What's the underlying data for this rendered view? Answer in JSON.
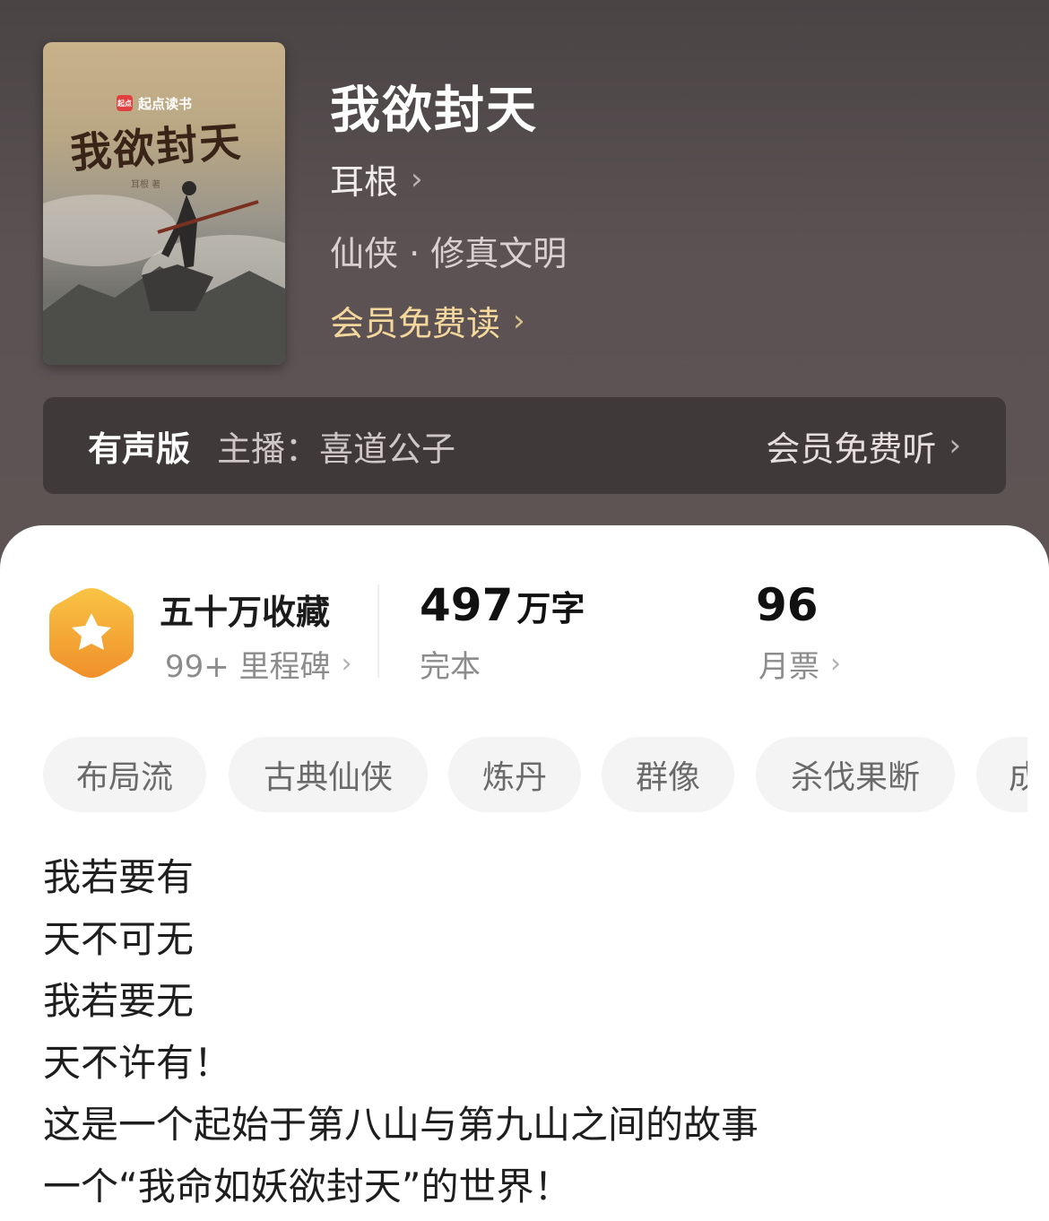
{
  "book": {
    "cover": {
      "brand": "起点读书",
      "title_art": "我欲封天",
      "author_small": "耳根 著"
    },
    "title": "我欲封天",
    "author": "耳根",
    "category": "仙侠 · 修真文明",
    "member_read": "会员免费读"
  },
  "audio": {
    "label": "有声版",
    "host": "主播：喜道公子",
    "listen": "会员免费听"
  },
  "stats": {
    "favorites_title": "五十万收藏",
    "milestones": "99+ 里程碑",
    "word_count_number": "497",
    "word_count_unit": "万字",
    "status": "完本",
    "monthly_tickets": "96",
    "monthly_tickets_label": "月票"
  },
  "tags": [
    "布局流",
    "古典仙侠",
    "炼丹",
    "群像",
    "杀伐果断",
    "成"
  ],
  "description": [
    "我若要有",
    "天不可无",
    "我若要无",
    "天不许有！",
    "这是一个起始于第八山与第九山之间的故事",
    "一个“我命如妖欲封天”的世界！"
  ],
  "colors": {
    "header_bg": "#5b5253",
    "audio_bar_bg": "#3f393a",
    "member_gold": "#f4d79c",
    "badge_orange": "#f3a233"
  }
}
